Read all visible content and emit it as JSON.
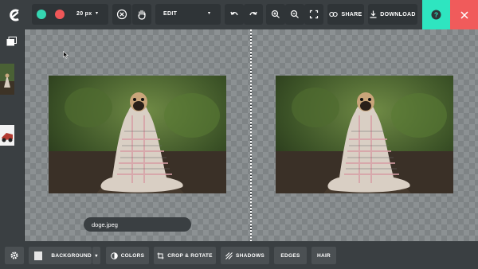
{
  "toolbar": {
    "brush_size": "20 px",
    "mode": "EDIT",
    "share_label": "SHARE",
    "download_label": "DOWNLOAD",
    "colors": {
      "keep": "#35d6b2",
      "remove": "#ef5758",
      "accent": "#2ee5c0",
      "close": "#f05b5b"
    }
  },
  "canvas": {
    "file_name": "doge.jpeg"
  },
  "bottom": {
    "background_label": "BACKGROUND",
    "colors_label": "COLORS",
    "crop_label": "CROP & ROTATE",
    "shadows_label": "SHADOWS",
    "edges_label": "EDGES",
    "hair_label": "HAIR"
  },
  "icons": [
    "logo-icon",
    "keep-dot-icon",
    "remove-dot-icon",
    "chevron-down-icon",
    "cancel-icon",
    "hand-icon",
    "undo-icon",
    "redo-icon",
    "zoom-in-icon",
    "zoom-out-icon",
    "fit-icon",
    "link-icon",
    "download-icon",
    "help-icon",
    "close-icon",
    "gallery-icon",
    "gear-icon",
    "contrast-icon",
    "crop-icon",
    "shadows-icon"
  ]
}
